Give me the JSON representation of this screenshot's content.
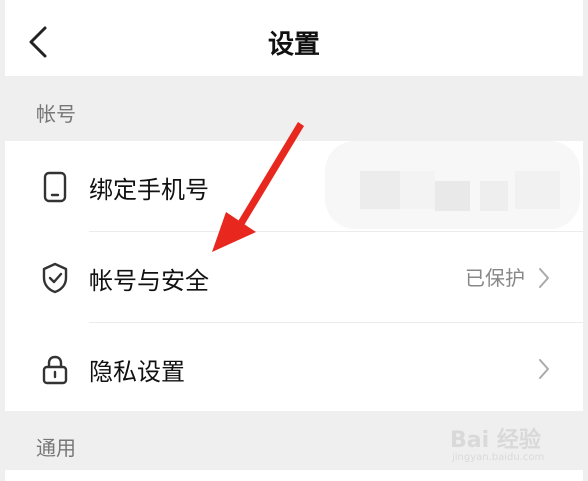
{
  "header": {
    "title": "设置",
    "back_icon": "chevron-left-icon"
  },
  "sections": [
    {
      "label": "帐号",
      "items": [
        {
          "label": "绑定手机号",
          "icon": "phone-icon",
          "value": "",
          "value_obscured": true
        },
        {
          "label": "帐号与安全",
          "icon": "shield-check-icon",
          "value": "已保护",
          "chevron": "chevron-right-icon"
        },
        {
          "label": "隐私设置",
          "icon": "lock-icon",
          "value": "",
          "chevron": "chevron-right-icon"
        }
      ]
    },
    {
      "label": "通用"
    }
  ],
  "annotation": {
    "type": "red-arrow",
    "color": "#e8281e"
  },
  "watermark": {
    "main": "Bai 经验",
    "sub": "jingyan.baidu.com"
  },
  "colors": {
    "background": "#efefef",
    "card": "#ffffff",
    "text": "#111111",
    "muted": "#888888",
    "arrow": "#e8281e"
  }
}
